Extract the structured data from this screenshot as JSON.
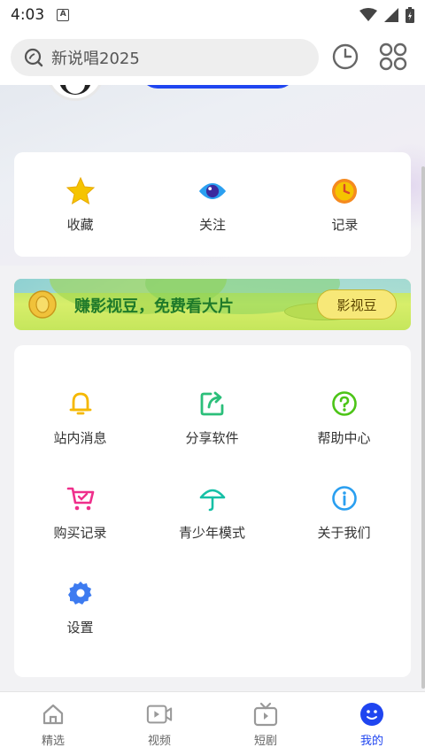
{
  "status_bar": {
    "time": "4:03",
    "notif_glyph": "A"
  },
  "header": {
    "search_placeholder": "新说唱2025",
    "icons": [
      "search-icon",
      "history-clock-icon",
      "apps-grid-icon"
    ]
  },
  "quick_actions": [
    {
      "label": "收藏",
      "icon": "star-icon"
    },
    {
      "label": "关注",
      "icon": "eye-icon"
    },
    {
      "label": "记录",
      "icon": "clock-icon"
    }
  ],
  "banner": {
    "text": "赚影视豆，免费看大片",
    "button_label": "影视豆",
    "icon": "coin-icon"
  },
  "tools": [
    {
      "label": "站内消息",
      "icon": "bell-icon"
    },
    {
      "label": "分享软件",
      "icon": "share-icon"
    },
    {
      "label": "帮助中心",
      "icon": "help-icon"
    },
    {
      "label": "购买记录",
      "icon": "cart-icon"
    },
    {
      "label": "青少年模式",
      "icon": "umbrella-icon"
    },
    {
      "label": "关于我们",
      "icon": "info-icon"
    },
    {
      "label": "设置",
      "icon": "settings-gear-icon"
    }
  ],
  "bottom_nav": [
    {
      "label": "精选",
      "icon": "home-icon",
      "active": false
    },
    {
      "label": "视频",
      "icon": "video-icon",
      "active": false
    },
    {
      "label": "短剧",
      "icon": "tv-icon",
      "active": false
    },
    {
      "label": "我的",
      "icon": "profile-face-icon",
      "active": true
    }
  ],
  "colors": {
    "accent": "#1f45f0",
    "star": "#f5c400",
    "eye": "#2a9ff0",
    "clock": "#f58a1f",
    "bell": "#f5b800",
    "share": "#2bbf7a",
    "help": "#4cc417",
    "cart": "#ef2f8b",
    "umbrella": "#16c0a6",
    "info": "#2a9ff0",
    "gear": "#3d7bf0"
  }
}
